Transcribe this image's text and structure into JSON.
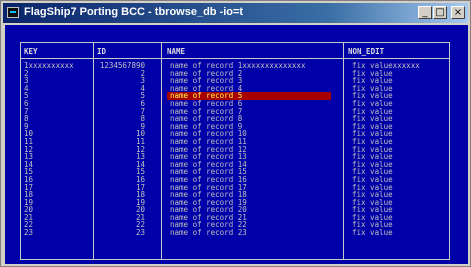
{
  "window": {
    "title": "FlagShip7 Porting BCC - tbrowse_db -io=t",
    "buttons": {
      "min": "_",
      "max": "□",
      "close": "×"
    }
  },
  "table": {
    "headers": [
      "KEY",
      "ID",
      "NAME",
      "NON_EDIT"
    ],
    "selected_index": 5,
    "rows": [
      {
        "key": "1xxxxxxxxxx",
        "id": "1234567890",
        "name": "name of record 1xxxxxxxxxxxxxx",
        "ne": "fix valuexxxxxx"
      },
      {
        "key": "2",
        "id": "2",
        "name": "name of record 2",
        "ne": "fix value"
      },
      {
        "key": "3",
        "id": "3",
        "name": "name of record 3",
        "ne": "fix value"
      },
      {
        "key": "4",
        "id": "4",
        "name": "name of record 4",
        "ne": "fix value"
      },
      {
        "key": "5",
        "id": "5",
        "name": "name of record 5",
        "ne": "fix value"
      },
      {
        "key": "6",
        "id": "6",
        "name": "name of record 6",
        "ne": "fix value"
      },
      {
        "key": "7",
        "id": "7",
        "name": "name of record 7",
        "ne": "fix value"
      },
      {
        "key": "8",
        "id": "8",
        "name": "name of record 8",
        "ne": "fix value"
      },
      {
        "key": "9",
        "id": "9",
        "name": "name of record 9",
        "ne": "fix value"
      },
      {
        "key": "10",
        "id": "10",
        "name": "name of record 10",
        "ne": "fix value"
      },
      {
        "key": "11",
        "id": "11",
        "name": "name of record 11",
        "ne": "fix value"
      },
      {
        "key": "12",
        "id": "12",
        "name": "name of record 12",
        "ne": "fix value"
      },
      {
        "key": "13",
        "id": "13",
        "name": "name of record 13",
        "ne": "fix value"
      },
      {
        "key": "14",
        "id": "14",
        "name": "name of record 14",
        "ne": "fix value"
      },
      {
        "key": "15",
        "id": "15",
        "name": "name of record 15",
        "ne": "fix value"
      },
      {
        "key": "16",
        "id": "16",
        "name": "name of record 16",
        "ne": "fix value"
      },
      {
        "key": "17",
        "id": "17",
        "name": "name of record 17",
        "ne": "fix value"
      },
      {
        "key": "18",
        "id": "18",
        "name": "name of record 18",
        "ne": "fix value"
      },
      {
        "key": "19",
        "id": "19",
        "name": "name of record 19",
        "ne": "fix value"
      },
      {
        "key": "20",
        "id": "20",
        "name": "name of record 20",
        "ne": "fix value"
      },
      {
        "key": "21",
        "id": "21",
        "name": "name of record 21",
        "ne": "fix value"
      },
      {
        "key": "22",
        "id": "22",
        "name": "name of record 22",
        "ne": "fix value"
      },
      {
        "key": "23",
        "id": "23",
        "name": "name of record 23",
        "ne": "fix value"
      }
    ]
  }
}
